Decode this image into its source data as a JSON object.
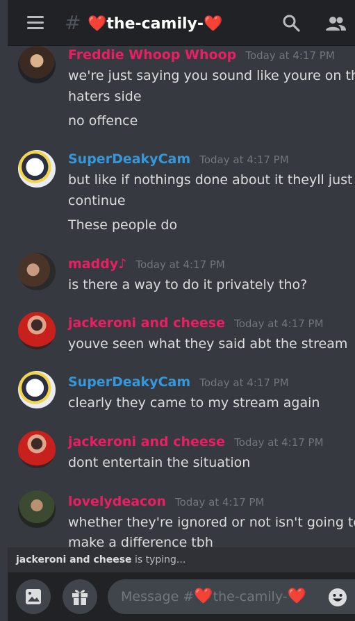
{
  "header": {
    "channel_prefix": "#",
    "channel_name": "the-camily-",
    "heart_left": "❤️",
    "heart_right": "❤️"
  },
  "colors": {
    "pink": "#e91e63",
    "blue": "#3498db",
    "bg": "#36393f",
    "header_bg": "#202225"
  },
  "messages": [
    {
      "author": "Freddie Whoop Whoop",
      "color": "#e91e63",
      "timestamp": "Today at 4:17 PM",
      "lines": [
        "we're just saying you sound like youre on the",
        "haters side",
        "no offence"
      ]
    },
    {
      "author": "SuperDeakyCam",
      "color": "#3498db",
      "timestamp": "Today at 4:17 PM",
      "lines": [
        "but like if nothings done about it theyll just",
        "continue",
        "These people do"
      ]
    },
    {
      "author": "maddy♪",
      "color": "#e91e63",
      "timestamp": "Today at 4:17 PM",
      "lines": [
        "is there a way to do it privately tho?"
      ]
    },
    {
      "author": "jackeroni and cheese",
      "color": "#e91e63",
      "timestamp": "Today at 4:17 PM",
      "lines": [
        "youve seen what they said abt the stream"
      ]
    },
    {
      "author": "SuperDeakyCam",
      "color": "#3498db",
      "timestamp": "Today at 4:17 PM",
      "lines": [
        "clearly they came to my stream again"
      ]
    },
    {
      "author": "jackeroni and cheese",
      "color": "#e91e63",
      "timestamp": "Today at 4:17 PM",
      "lines": [
        "dont entertain the situation"
      ]
    },
    {
      "author": "lovelydeacon",
      "color": "#e91e63",
      "timestamp": "Today at 4:17 PM",
      "lines": [
        "whether they're ignored or not isn't going to",
        "make a difference tbh"
      ]
    }
  ],
  "typing": {
    "user": "jackeroni and cheese",
    "suffix": " is typing..."
  },
  "composer": {
    "placeholder_prefix": "Message #",
    "placeholder_channel": "the-camily-",
    "heart": "❤️"
  },
  "icons": {
    "menu": "hamburger-menu-icon",
    "channel": "hash-icon",
    "search": "search-icon",
    "members": "members-icon",
    "image": "image-icon",
    "gift": "gift-icon",
    "emoji": "emoji-icon"
  }
}
